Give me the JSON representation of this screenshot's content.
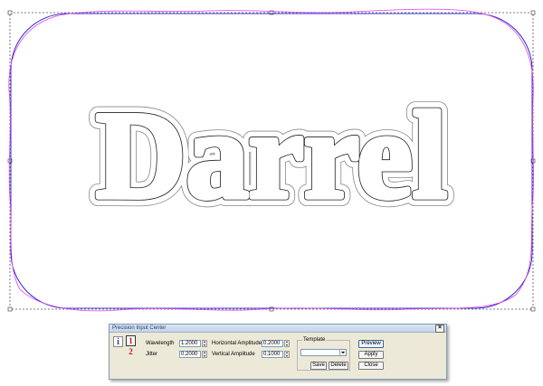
{
  "canvas": {
    "text": "Darrel"
  },
  "dialog": {
    "title": "Precision Input Center",
    "close_label": "×",
    "info_icon_label": "i",
    "icon_one_label": "1",
    "icon_two_label": "2",
    "wavelength_label": "Wavelength",
    "wavelength_value": "1.2000",
    "jitter_label": "Jitter",
    "jitter_value": "0.2000",
    "horizontal_amplitude_label": "Horizontal Amplitude",
    "horizontal_amplitude_value": "0.2000",
    "vertical_amplitude_label": "Vertical Amplitude",
    "vertical_amplitude_value": "0.1000",
    "template_label": "Template",
    "template_value": "",
    "save_label": "Save",
    "delete_label": "Delete",
    "preview_label": "Preview",
    "apply_label": "Apply",
    "close_button_label": "Close"
  },
  "colors": {
    "blue_outline": "#0000cc",
    "magenta_outline": "#e040e0",
    "selection_dots": "#555555"
  }
}
